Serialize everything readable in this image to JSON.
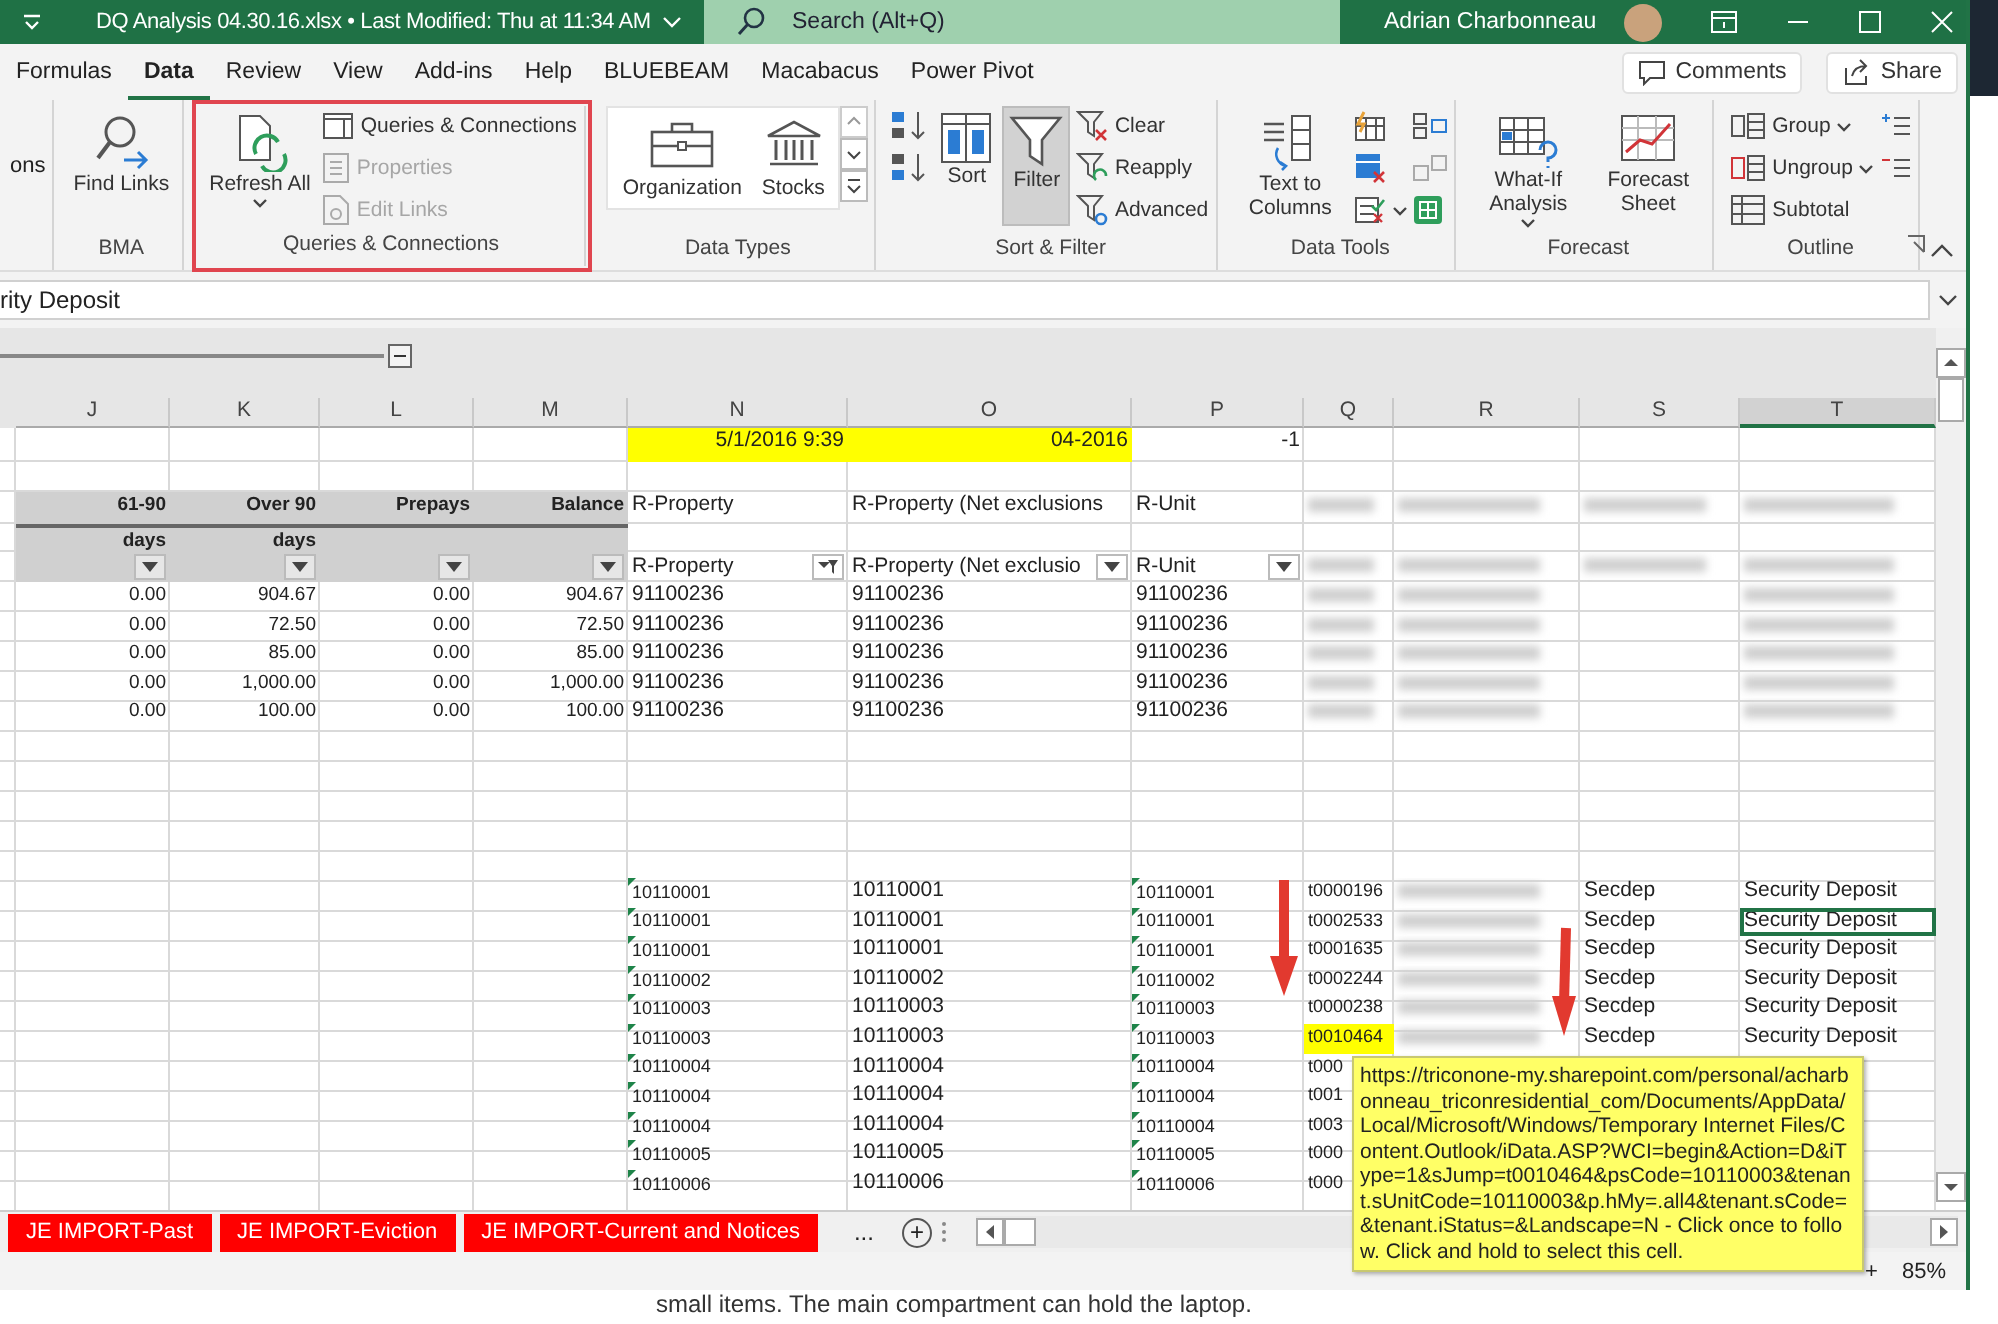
{
  "title_bar": {
    "document": "DQ Analysis 04.30.16.xlsx • Last Modified: Thu at 11:34 AM",
    "search": {
      "placeholder": "Search (Alt+Q)"
    },
    "user": "Adrian Charbonneau"
  },
  "menu": {
    "tabs": [
      {
        "label": "Formulas",
        "selected": false
      },
      {
        "label": "Data",
        "selected": true
      },
      {
        "label": "Review",
        "selected": false
      },
      {
        "label": "View",
        "selected": false
      },
      {
        "label": "Add-ins",
        "selected": false
      },
      {
        "label": "Help",
        "selected": false
      },
      {
        "label": "BLUEBEAM",
        "selected": false
      },
      {
        "label": "Macabacus",
        "selected": false
      },
      {
        "label": "Power Pivot",
        "selected": false
      }
    ],
    "buttons": [
      "Comments",
      "Share"
    ]
  },
  "ribbon": {
    "groups": [
      {
        "columns": [
          [
            {
              "kind": "text",
              "label": "ons"
            }
          ]
        ]
      },
      {
        "label": "BMA",
        "columns": [
          [
            {
              "kind": "large",
              "label": "Find Links"
            }
          ]
        ]
      },
      {
        "label": "Queries & Connections",
        "highlighted": true,
        "columns": [
          [
            {
              "kind": "large",
              "label": "Refresh All",
              "dropdown": true
            }
          ],
          [
            {
              "kind": "small",
              "label": "Queries & Connections",
              "disabled": false
            },
            {
              "kind": "small",
              "label": "Properties",
              "disabled": true
            },
            {
              "kind": "small",
              "label": "Edit Links",
              "disabled": true
            }
          ]
        ]
      },
      {
        "label": "Data Types",
        "columns": [
          [
            {
              "kind": "gallery",
              "options": [
                "Organization",
                "Stocks"
              ]
            }
          ]
        ]
      },
      {
        "label": "Sort & Filter",
        "columns": [
          [
            {
              "kind": "icon"
            },
            {
              "kind": "icon"
            }
          ],
          [
            {
              "kind": "large",
              "label": "Sort"
            }
          ],
          [
            {
              "kind": "large",
              "label": "Filter",
              "pressed": true
            }
          ],
          [
            {
              "kind": "small",
              "label": "Clear",
              "disabled": false
            },
            {
              "kind": "small",
              "label": "Reapply",
              "disabled": false
            },
            {
              "kind": "small",
              "label": "Advanced",
              "disabled": false
            }
          ]
        ]
      },
      {
        "label": "Data Tools",
        "columns": [
          [
            {
              "kind": "large",
              "label": "Text to Columns"
            }
          ],
          [
            {
              "kind": "icon"
            },
            {
              "kind": "icon"
            },
            {
              "kind": "icon",
              "dropdown": true
            }
          ],
          [
            {
              "kind": "icon"
            },
            {
              "kind": "icon"
            },
            {
              "kind": "icon"
            }
          ]
        ]
      },
      {
        "label": "Forecast",
        "columns": [
          [
            {
              "kind": "large",
              "label": "What-If Analysis",
              "dropdown": true
            }
          ],
          [
            {
              "kind": "large",
              "label": "Forecast Sheet"
            }
          ]
        ]
      },
      {
        "label": "Outline",
        "columns": [
          [
            {
              "kind": "small",
              "label": "Group",
              "disabled": false,
              "dropdown": true
            },
            {
              "kind": "small",
              "label": "Ungroup",
              "disabled": false,
              "dropdown": true
            },
            {
              "kind": "small",
              "label": "Subtotal",
              "disabled": false
            }
          ],
          [
            {
              "kind": "icon"
            },
            {
              "kind": "icon"
            }
          ]
        ]
      }
    ]
  },
  "formula_bar": {
    "value": "rity Deposit"
  },
  "sheet": {
    "columns": [
      {
        "letter": "J",
        "selected": false
      },
      {
        "letter": "K",
        "selected": false
      },
      {
        "letter": "L",
        "selected": false
      },
      {
        "letter": "M",
        "selected": false
      },
      {
        "letter": "N",
        "selected": false
      },
      {
        "letter": "O",
        "selected": false
      },
      {
        "letter": "P",
        "selected": false
      },
      {
        "letter": "Q",
        "selected": false
      },
      {
        "letter": "R",
        "selected": false
      },
      {
        "letter": "S",
        "selected": false
      },
      {
        "letter": "T",
        "selected": true
      }
    ],
    "rows": [
      {
        "kind": "values",
        "cells": [
          null,
          null,
          null,
          null,
          {
            "text": "5/1/2016 9:39",
            "numeric": true,
            "highlighted": true
          },
          {
            "text": "04-2016",
            "numeric": true,
            "highlighted": true
          },
          {
            "text": "-1",
            "numeric": true,
            "highlighted": false
          },
          null,
          null,
          null,
          null
        ]
      },
      {
        "kind": "blank"
      },
      {
        "kind": "header",
        "cells": [
          {
            "text": "61-90",
            "numeric": true,
            "shaded": true
          },
          {
            "text": "Over 90",
            "numeric": true,
            "shaded": true
          },
          {
            "text": "Prepays",
            "numeric": true,
            "shaded": true
          },
          {
            "text": "Balance",
            "numeric": true,
            "shaded": true
          },
          {
            "text": "R-Property"
          },
          {
            "text": "R-Property (Net exclusions"
          },
          {
            "text": "R-Unit"
          },
          {
            "kind": "redacted"
          },
          {
            "kind": "redacted"
          },
          {
            "kind": "redacted"
          },
          {
            "kind": "redacted"
          }
        ]
      },
      {
        "kind": "subheader",
        "cells": [
          {
            "text": "days",
            "numeric": true,
            "shaded": true
          },
          {
            "text": "days",
            "numeric": true,
            "shaded": true
          },
          {
            "shaded": true
          },
          {
            "shaded": true
          },
          null,
          null,
          null,
          null,
          null,
          null,
          null
        ]
      },
      {
        "kind": "filter",
        "cells": [
          {
            "shaded": true,
            "filtered": false
          },
          {
            "shaded": true,
            "filtered": false
          },
          {
            "shaded": true,
            "filtered": false
          },
          {
            "shaded": true,
            "filtered": false
          },
          {
            "text": "R-Property",
            "filtered": true
          },
          {
            "text": "R-Property (Net exclusio",
            "filtered": false
          },
          {
            "text": "R-Unit",
            "filtered": false
          },
          {
            "kind": "redacted"
          },
          {
            "kind": "redacted"
          },
          {
            "kind": "redacted"
          },
          {
            "kind": "redacted"
          }
        ]
      },
      {
        "kind": "data",
        "cells": [
          {
            "text": "0.00",
            "numeric": true
          },
          {
            "text": "904.67",
            "numeric": true
          },
          {
            "text": "0.00",
            "numeric": true
          },
          {
            "text": "904.67",
            "numeric": true
          },
          {
            "text": "91100236"
          },
          {
            "text": "91100236"
          },
          {
            "text": "91100236"
          },
          {
            "kind": "redacted"
          },
          {
            "kind": "redacted"
          },
          null,
          {
            "kind": "redacted"
          }
        ]
      },
      {
        "kind": "data",
        "cells": [
          {
            "text": "0.00",
            "numeric": true
          },
          {
            "text": "72.50",
            "numeric": true
          },
          {
            "text": "0.00",
            "numeric": true
          },
          {
            "text": "72.50",
            "numeric": true
          },
          {
            "text": "91100236"
          },
          {
            "text": "91100236"
          },
          {
            "text": "91100236"
          },
          {
            "kind": "redacted"
          },
          {
            "kind": "redacted"
          },
          null,
          {
            "kind": "redacted"
          }
        ]
      },
      {
        "kind": "data",
        "cells": [
          {
            "text": "0.00",
            "numeric": true
          },
          {
            "text": "85.00",
            "numeric": true
          },
          {
            "text": "0.00",
            "numeric": true
          },
          {
            "text": "85.00",
            "numeric": true
          },
          {
            "text": "91100236"
          },
          {
            "text": "91100236"
          },
          {
            "text": "91100236"
          },
          {
            "kind": "redacted"
          },
          {
            "kind": "redacted"
          },
          null,
          {
            "kind": "redacted"
          }
        ]
      },
      {
        "kind": "data",
        "cells": [
          {
            "text": "0.00",
            "numeric": true
          },
          {
            "text": "1,000.00",
            "numeric": true
          },
          {
            "text": "0.00",
            "numeric": true
          },
          {
            "text": "1,000.00",
            "numeric": true
          },
          {
            "text": "91100236"
          },
          {
            "text": "91100236"
          },
          {
            "text": "91100236"
          },
          {
            "kind": "redacted"
          },
          {
            "kind": "redacted"
          },
          null,
          {
            "kind": "redacted"
          }
        ]
      },
      {
        "kind": "data",
        "cells": [
          {
            "text": "0.00",
            "numeric": true
          },
          {
            "text": "100.00",
            "numeric": true
          },
          {
            "text": "0.00",
            "numeric": true
          },
          {
            "text": "100.00",
            "numeric": true
          },
          {
            "text": "91100236"
          },
          {
            "text": "91100236"
          },
          {
            "text": "91100236"
          },
          {
            "kind": "redacted"
          },
          {
            "kind": "redacted"
          },
          null,
          {
            "kind": "redacted"
          }
        ]
      },
      {
        "kind": "blank"
      },
      {
        "kind": "blank"
      },
      {
        "kind": "blank"
      },
      {
        "kind": "blank"
      },
      {
        "kind": "blank"
      },
      {
        "kind": "detail",
        "cells": [
          null,
          null,
          null,
          null,
          {
            "text": "10110001",
            "flagged": true
          },
          {
            "text": "10110001"
          },
          {
            "text": "10110001",
            "flagged": true
          },
          {
            "text": "t0000196",
            "highlighted": false
          },
          {
            "kind": "redacted"
          },
          {
            "text": "Secdep"
          },
          {
            "text": "Security Deposit",
            "selected": false
          }
        ]
      },
      {
        "kind": "detail",
        "cells": [
          null,
          null,
          null,
          null,
          {
            "text": "10110001",
            "flagged": true
          },
          {
            "text": "10110001"
          },
          {
            "text": "10110001",
            "flagged": true
          },
          {
            "text": "t0002533",
            "highlighted": false
          },
          {
            "kind": "redacted"
          },
          {
            "text": "Secdep"
          },
          {
            "text": "Security Deposit",
            "selected": true
          }
        ]
      },
      {
        "kind": "detail",
        "cells": [
          null,
          null,
          null,
          null,
          {
            "text": "10110001",
            "flagged": true
          },
          {
            "text": "10110001"
          },
          {
            "text": "10110001",
            "flagged": true
          },
          {
            "text": "t0001635",
            "highlighted": false
          },
          {
            "kind": "redacted"
          },
          {
            "text": "Secdep"
          },
          {
            "text": "Security Deposit",
            "selected": false
          }
        ]
      },
      {
        "kind": "detail",
        "cells": [
          null,
          null,
          null,
          null,
          {
            "text": "10110002",
            "flagged": true
          },
          {
            "text": "10110002"
          },
          {
            "text": "10110002",
            "flagged": true
          },
          {
            "text": "t0002244",
            "highlighted": false
          },
          {
            "kind": "redacted"
          },
          {
            "text": "Secdep"
          },
          {
            "text": "Security Deposit",
            "selected": false
          }
        ]
      },
      {
        "kind": "detail",
        "cells": [
          null,
          null,
          null,
          null,
          {
            "text": "10110003",
            "flagged": true
          },
          {
            "text": "10110003"
          },
          {
            "text": "10110003",
            "flagged": true
          },
          {
            "text": "t0000238",
            "highlighted": false
          },
          {
            "kind": "redacted"
          },
          {
            "text": "Secdep"
          },
          {
            "text": "Security Deposit",
            "selected": false
          }
        ]
      },
      {
        "kind": "detail",
        "cells": [
          null,
          null,
          null,
          null,
          {
            "text": "10110003",
            "flagged": true
          },
          {
            "text": "10110003"
          },
          {
            "text": "10110003",
            "flagged": true
          },
          {
            "text": "t0010464",
            "highlighted": true
          },
          {
            "kind": "redacted"
          },
          {
            "text": "Secdep"
          },
          {
            "text": "Security Deposit",
            "selected": false
          }
        ]
      },
      {
        "kind": "detail",
        "cells": [
          null,
          null,
          null,
          null,
          {
            "text": "10110004",
            "flagged": true
          },
          {
            "text": "10110004"
          },
          {
            "text": "10110004",
            "flagged": true
          },
          {
            "text": "t000"
          },
          null,
          null,
          null
        ]
      },
      {
        "kind": "detail",
        "cells": [
          null,
          null,
          null,
          null,
          {
            "text": "10110004",
            "flagged": true
          },
          {
            "text": "10110004"
          },
          {
            "text": "10110004",
            "flagged": true
          },
          {
            "text": "t001"
          },
          null,
          null,
          null
        ]
      },
      {
        "kind": "detail",
        "cells": [
          null,
          null,
          null,
          null,
          {
            "text": "10110004",
            "flagged": true
          },
          {
            "text": "10110004"
          },
          {
            "text": "10110004",
            "flagged": true
          },
          {
            "text": "t003"
          },
          null,
          null,
          null
        ]
      },
      {
        "kind": "detail",
        "cells": [
          null,
          null,
          null,
          null,
          {
            "text": "10110005",
            "flagged": true
          },
          {
            "text": "10110005"
          },
          {
            "text": "10110005",
            "flagged": true
          },
          {
            "text": "t000"
          },
          null,
          null,
          null
        ]
      },
      {
        "kind": "detail",
        "cells": [
          null,
          null,
          null,
          null,
          {
            "text": "10110006",
            "flagged": true
          },
          {
            "text": "10110006"
          },
          {
            "text": "10110006",
            "flagged": true
          },
          {
            "text": "t000"
          },
          null,
          null,
          null
        ]
      }
    ],
    "tooltip": "https://triconone-my.sharepoint.com/personal/acharbonneau_triconresidential_com/Documents/AppData/Local/Microsoft/Windows/Temporary Internet Files/Content.Outlook/iData.ASP?WCI=begin&Action=D&iType=1&sJump=t0010464&psCode=10110003&tenant.sUnitCode=10110003&p.hMy=.all4&tenant.sCode=&tenant.iStatus=&Landscape=N - Click once to follow. Click and hold to select this cell."
  },
  "sheet_tabs": [
    {
      "label": "JE IMPORT-Past",
      "selected": false
    },
    {
      "label": "JE IMPORT-Eviction",
      "selected": false
    },
    {
      "label": "JE IMPORT-Current and Notices",
      "selected": false
    }
  ],
  "tab_bar": {
    "more": "...",
    "add": "+"
  },
  "status_bar": {
    "zoom_in": "+",
    "zoom": "85%"
  },
  "background_text": "small items. The main compartment can hold the laptop."
}
